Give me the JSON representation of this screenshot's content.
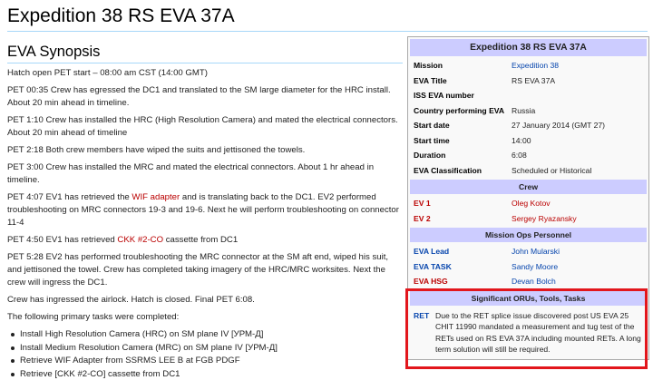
{
  "page": {
    "title": "Expedition 38 RS EVA 37A",
    "section_title": "EVA Synopsis"
  },
  "synopsis": {
    "p0": "Hatch open PET start – 08:00 am CST (14:00 GMT)",
    "p1": "PET 00:35 Crew has egressed the DC1 and translated to the SM large diameter for the HRC install. About 20 min ahead in timeline.",
    "p2": "PET 1:10 Crew has installed the HRC (High Resolution Camera) and mated the electrical connectors. About 20 min ahead of timeline",
    "p3": "PET 2:18 Both crew members have wiped the suits and jettisoned the towels.",
    "p4": "PET 3:00 Crew has installed the MRC and mated the electrical connectors. About 1 hr ahead in timeline.",
    "p5_before": "PET 4:07 EV1 has retrieved the ",
    "p5_link": "WIF adapter",
    "p5_after": " and is translating back to the DC1. EV2 performed troubleshooting on MRC connectors 19-3 and 19-6. Next he will perform troubleshooting on connector 11-4",
    "p6_before": "PET 4:50 EV1 has retrieved ",
    "p6_link": "CKK #2-CO",
    "p6_after": " cassette from DC1",
    "p7": "PET 5:28 EV2 has performed troubleshooting the MRC connector at the SM aft end, wiped his suit, and jettisoned the towel. Crew has completed taking imagery of the HRC/MRC worksites. Next the crew will ingress the DC1.",
    "p8": "Crew has ingressed the airlock. Hatch is closed. Final PET 6:08.",
    "p9": "The following primary tasks were completed:",
    "tasks": [
      "Install High Resolution Camera (HRC) on SM plane IV [УРМ-Д]",
      "Install Medium Resolution Camera (MRC) on SM plane IV [УРМ-Д]",
      "Retrieve WIF Adapter from SSRMS LEE B at FGB PDGF",
      "Retrieve [CKK #2-CO] cassette from DC1"
    ]
  },
  "infobox": {
    "title": "Expedition 38 RS EVA 37A",
    "rows": [
      {
        "label": "Mission",
        "value": "Expedition 38"
      },
      {
        "label": "EVA Title",
        "value": "RS EVA 37A"
      },
      {
        "label": "ISS EVA number",
        "value": ""
      },
      {
        "label": "Country performing EVA",
        "value": "Russia"
      },
      {
        "label": "Start date",
        "value": "27 January 2014 (GMT 27)"
      },
      {
        "label": "Start time",
        "value": "14:00"
      },
      {
        "label": "Duration",
        "value": "6:08"
      },
      {
        "label": "EVA Classification",
        "value": "Scheduled or Historical"
      }
    ],
    "crew_header": "Crew",
    "crew": [
      {
        "label": "EV 1",
        "value": "Oleg Kotov"
      },
      {
        "label": "EV 2",
        "value": "Sergey Ryazansky"
      }
    ],
    "ops_header": "Mission Ops Personnel",
    "ops": [
      {
        "label": "EVA Lead",
        "value": "John Mularski"
      },
      {
        "label": "EVA TASK",
        "value": "Sandy Moore"
      },
      {
        "label": "EVA HSG",
        "value": "Devan Bolch"
      }
    ],
    "orus_header": "Significant ORUs, Tools, Tasks",
    "notes_label": "RET",
    "notes_text": "Due to the RET splice issue discovered post US EVA 25 CHIT 11990 mandated a measurement and tug test of the RETs used on RS EVA 37A including mounted RETs. A long term solution will still be required."
  },
  "colors": {
    "link": "#0645ad",
    "redlink": "#ba0000",
    "infobox_header": "#ccccff",
    "highlight_border": "#e2161c"
  }
}
